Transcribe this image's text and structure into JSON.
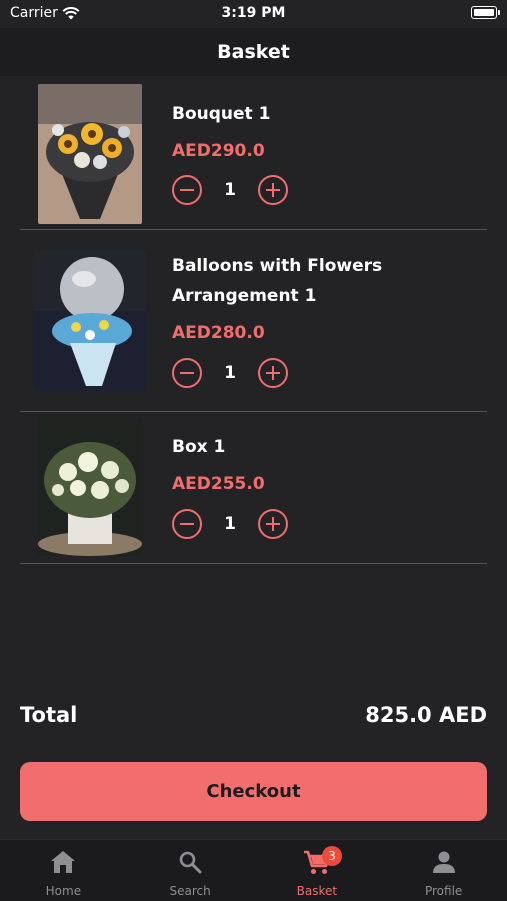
{
  "status_bar": {
    "carrier": "Carrier",
    "time": "3:19 PM"
  },
  "nav": {
    "title": "Basket"
  },
  "items": [
    {
      "name": "Bouquet 1",
      "price": "AED290.0",
      "quantity": "1"
    },
    {
      "name": "Balloons with Flowers Arrangement 1",
      "price": "AED280.0",
      "quantity": "1"
    },
    {
      "name": "Box 1",
      "price": "AED255.0",
      "quantity": "1"
    }
  ],
  "total": {
    "label": "Total",
    "value": "825.0 AED"
  },
  "checkout_label": "Checkout",
  "tabs": [
    {
      "label": "Home",
      "icon": "home-icon"
    },
    {
      "label": "Search",
      "icon": "search-icon"
    },
    {
      "label": "Basket",
      "icon": "cart-icon",
      "badge": "3",
      "active": true
    },
    {
      "label": "Profile",
      "icon": "person-icon"
    }
  ],
  "colors": {
    "accent": "#f26d6d",
    "background": "#232326",
    "badge": "#ee4b3b"
  }
}
